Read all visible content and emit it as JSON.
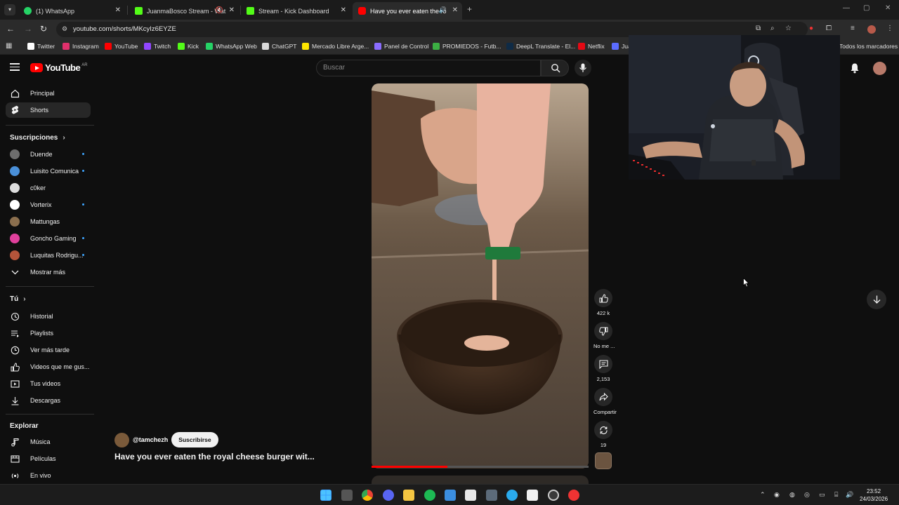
{
  "browser": {
    "tabs": [
      {
        "title": "(1) WhatsApp",
        "favicon": "whatsapp-icon",
        "active": false
      },
      {
        "title": "JuanmaBosco Stream - Wat",
        "favicon": "kick-icon",
        "active": false,
        "muted": true
      },
      {
        "title": "Stream - Kick Dashboard",
        "favicon": "kick-icon",
        "active": false
      },
      {
        "title": "Have you ever eaten the ro",
        "favicon": "youtube-icon",
        "active": true,
        "audio": true
      }
    ],
    "url": "youtube.com/shorts/MKcyIz6EYZE",
    "bookmarks": [
      {
        "label": "Twitter",
        "color": "#ffffff"
      },
      {
        "label": "Instagram",
        "color": "#e1306c"
      },
      {
        "label": "YouTube",
        "color": "#ff0000"
      },
      {
        "label": "Twitch",
        "color": "#9146ff"
      },
      {
        "label": "Kick",
        "color": "#53fc18"
      },
      {
        "label": "WhatsApp Web",
        "color": "#25d366"
      },
      {
        "label": "ChatGPT",
        "color": "#d9d9d9"
      },
      {
        "label": "Mercado Libre Arge...",
        "color": "#ffe600"
      },
      {
        "label": "Panel de Control",
        "color": "#8a6cff"
      },
      {
        "label": "PROMIEDOS - Futb...",
        "color": "#3cb043"
      },
      {
        "label": "DeepL Translate - El...",
        "color": "#0f2b46"
      },
      {
        "label": "Netflix",
        "color": "#e50914"
      },
      {
        "label": "Jua",
        "color": "#5b6cff"
      }
    ],
    "all_bookmarks": "Todos los marcadores"
  },
  "youtube": {
    "logo": "YouTube",
    "country": "AR",
    "search_placeholder": "Buscar",
    "nav": [
      {
        "label": "Principal",
        "icon": "home-icon"
      },
      {
        "label": "Shorts",
        "icon": "shorts-icon",
        "selected": true
      }
    ],
    "subscriptions_header": "Suscripciones",
    "subscriptions": [
      {
        "label": "Duende",
        "color": "#6e6e6e",
        "new": true
      },
      {
        "label": "Luisito Comunica",
        "color": "#4a90d9",
        "new": true
      },
      {
        "label": "c0ker",
        "color": "#dddddd",
        "new": false
      },
      {
        "label": "Vorterix",
        "color": "#ffffff",
        "new": true
      },
      {
        "label": "Mattungas",
        "color": "#8b6f4e",
        "new": false
      },
      {
        "label": "Goncho Gaming",
        "color": "#e0409c",
        "new": true
      },
      {
        "label": "Luquitas Rodrigu...",
        "color": "#b5543a",
        "new": true
      }
    ],
    "show_more": "Mostrar más",
    "you_header": "Tú",
    "you_items": [
      {
        "label": "Historial",
        "icon": "history-icon"
      },
      {
        "label": "Playlists",
        "icon": "playlist-icon"
      },
      {
        "label": "Ver más tarde",
        "icon": "clock-icon"
      },
      {
        "label": "Videos que me gus...",
        "icon": "thumbs-up-icon"
      },
      {
        "label": "Tus videos",
        "icon": "video-icon"
      },
      {
        "label": "Descargas",
        "icon": "download-icon"
      }
    ],
    "explore_header": "Explorar",
    "explore_items": [
      {
        "label": "Música",
        "icon": "music-icon"
      },
      {
        "label": "Películas",
        "icon": "film-icon"
      },
      {
        "label": "En vivo",
        "icon": "live-icon"
      }
    ],
    "short": {
      "channel": "@tamchezh",
      "subscribe": "Suscribirse",
      "title": "Have you ever eaten the royal cheese burger wit...",
      "likes": "422 k",
      "dislike": "No me ...",
      "comments": "2,153",
      "share": "Compartir",
      "remix": "19",
      "progress": 0.35
    }
  },
  "taskbar": {
    "time": "23:52",
    "date": "24/03/2026"
  }
}
